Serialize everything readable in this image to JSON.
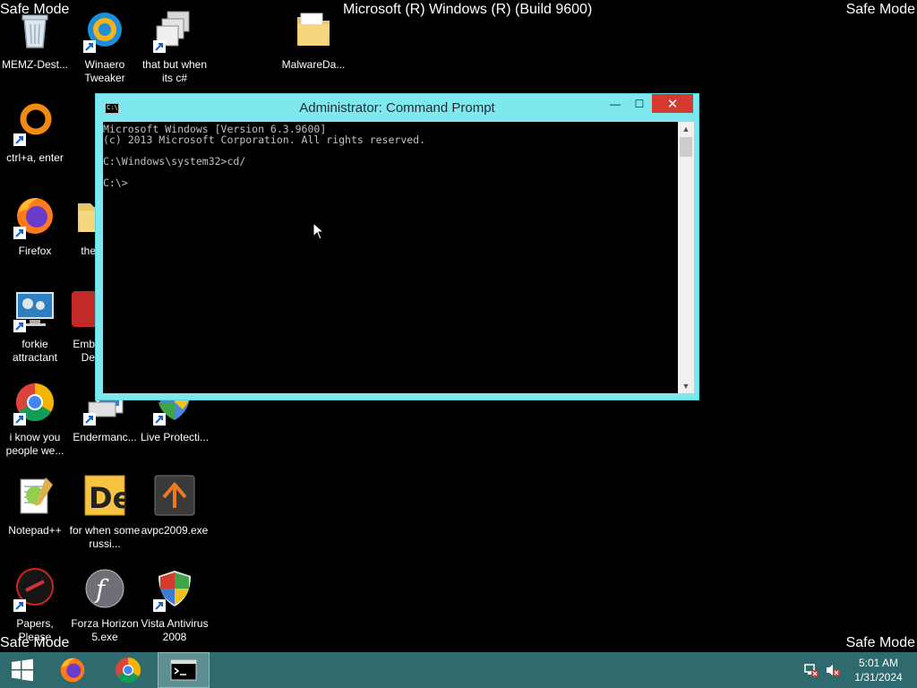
{
  "overlay": {
    "safe_mode": "Safe Mode",
    "build": "Microsoft (R) Windows (R) (Build 9600)"
  },
  "desktop_icons": [
    {
      "label": "MEMZ-Dest...",
      "icon": "recycle-bin-icon"
    },
    {
      "label": "Winaero Tweaker",
      "icon": "winaero-icon"
    },
    {
      "label": "that but when its c#",
      "icon": "shortcut-windows-icon"
    },
    {
      "label": "MalwareDa...",
      "icon": "folder-icon"
    },
    {
      "label": "ctrl+a, enter",
      "icon": "orange-ring-icon"
    },
    {
      "label": "Firefox",
      "icon": "firefox-icon"
    },
    {
      "label": "the",
      "icon": "folder-icon"
    },
    {
      "label": "forkie attractant",
      "icon": "settings-monitor-icon"
    },
    {
      "label": "Emb De",
      "icon": "red-app-icon"
    },
    {
      "label": "i know you people we...",
      "icon": "chrome-icon"
    },
    {
      "label": "Endermanc...",
      "icon": "installer-icon"
    },
    {
      "label": "Live Protecti...",
      "icon": "shield-icon"
    },
    {
      "label": "Notepad++",
      "icon": "notepadpp-icon"
    },
    {
      "label": "for when some russi...",
      "icon": "de-icon"
    },
    {
      "label": "avpc2009.exe",
      "icon": "avpc-icon"
    },
    {
      "label": "Papers, Please",
      "icon": "papers-please-icon"
    },
    {
      "label": "Forza Horizon 5.exe",
      "icon": "flash-icon"
    },
    {
      "label": "Vista Antivirus 2008",
      "icon": "shield-icon"
    }
  ],
  "cmd_window": {
    "title": "Administrator: Command Prompt",
    "system_icon_text": "C:\\_",
    "lines": [
      "Microsoft Windows [Version 6.3.9600]",
      "(c) 2013 Microsoft Corporation. All rights reserved.",
      "",
      "C:\\Windows\\system32>cd/",
      "",
      "C:\\>"
    ],
    "minimize": "—",
    "maximize": "☐",
    "close": "✕"
  },
  "taskbar": {
    "items": [
      "start-button",
      "firefox",
      "chrome",
      "command-prompt"
    ],
    "clock_time": "5:01 AM",
    "clock_date": "1/31/2024"
  },
  "colors": {
    "desktop": "#000000",
    "cmd_frame": "#7fe8ee",
    "close_button": "#d43a2f",
    "taskbar": "#2f6a6e"
  }
}
